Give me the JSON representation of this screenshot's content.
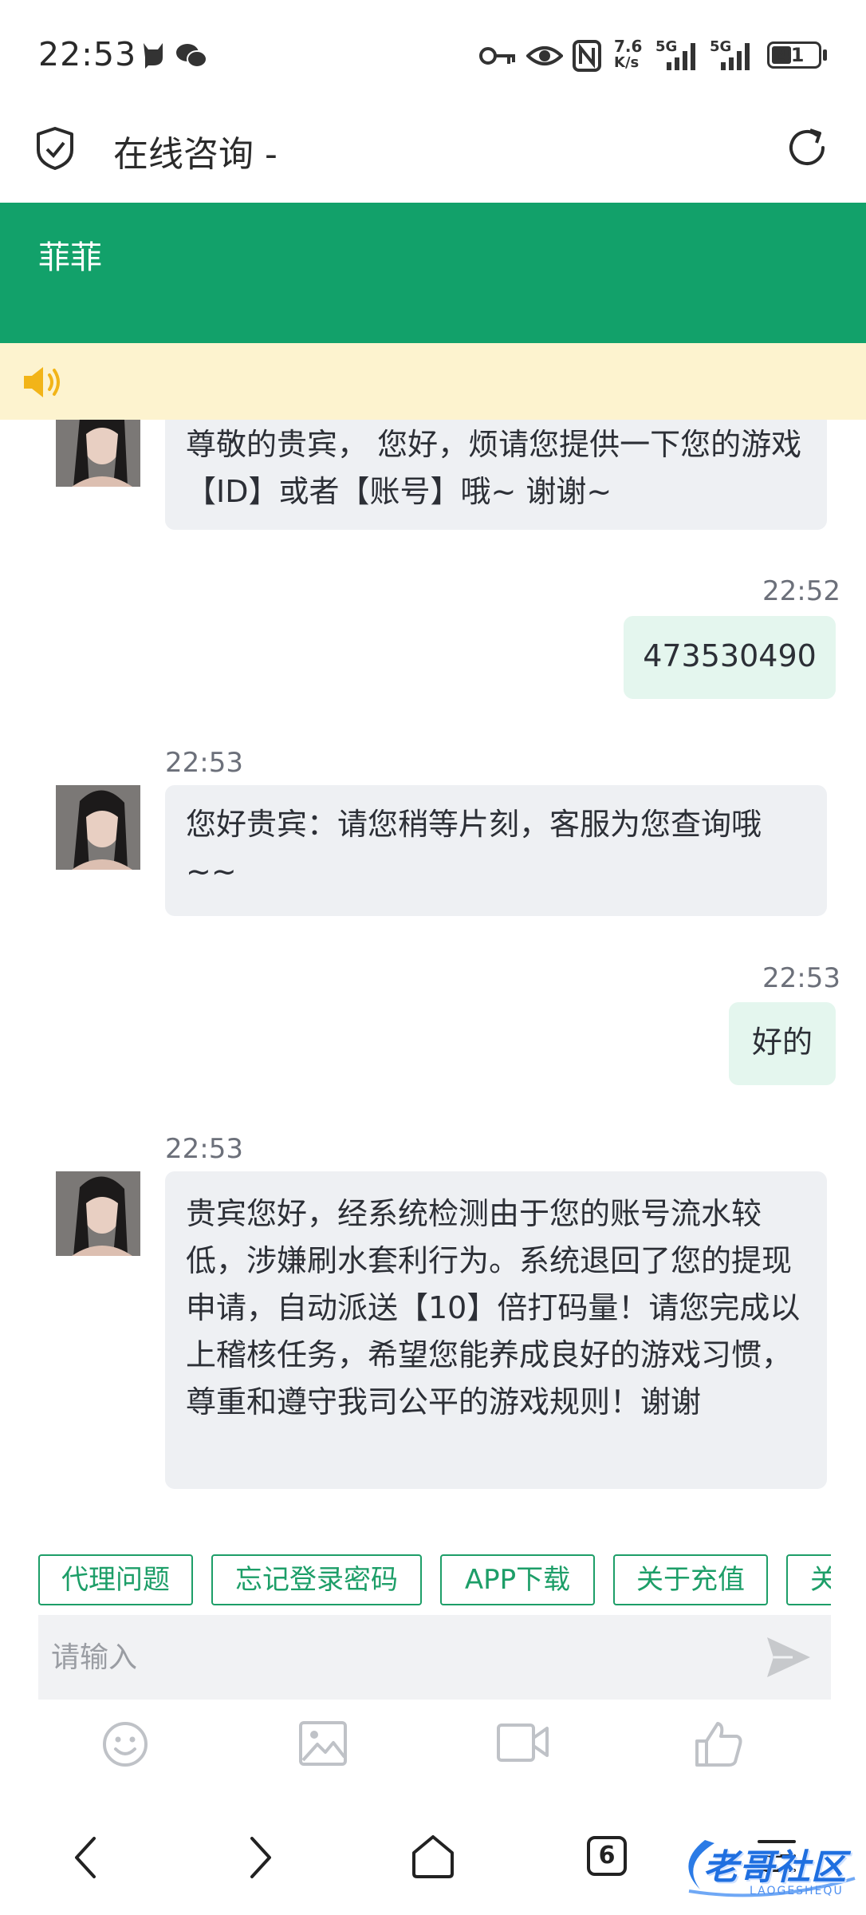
{
  "status_bar": {
    "time": "22:53",
    "net_speed": "7.6",
    "net_unit": "K/s",
    "signal1": "5G",
    "signal2": "5G",
    "battery": "41"
  },
  "browser": {
    "page_title": "在线咨询 -"
  },
  "chat": {
    "agent_name": "菲菲",
    "messages": [
      {
        "direction": "in",
        "time": "",
        "text": "尊敬的贵宾， 您好，烦请您提供一下您的游戏【ID】或者【账号】哦~ 谢谢~"
      },
      {
        "direction": "out",
        "time": "22:52",
        "text": "473530490"
      },
      {
        "direction": "in",
        "time": "22:53",
        "text": "您好贵宾：请您稍等片刻，客服为您查询哦~~"
      },
      {
        "direction": "out",
        "time": "22:53",
        "text": "好的"
      },
      {
        "direction": "in",
        "time": "22:53",
        "text": "贵宾您好，经系统检测由于您的账号流水较低，涉嫌刷水套利行为。系统退回了您的提现申请，自动派送【10】倍打码量！请您完成以上稽核任务，希望您能养成良好的游戏习惯，尊重和遵守我司公平的游戏规则！谢谢"
      }
    ]
  },
  "quick_replies": [
    "代理问题",
    "忘记登录密码",
    "APP下载",
    "关于充值",
    "关"
  ],
  "input": {
    "placeholder": "请输入",
    "value": ""
  },
  "nav": {
    "tab_count": "6"
  },
  "watermark": {
    "text": "老哥社区",
    "sub": "LAOGESHEQU"
  },
  "colors": {
    "header_green": "#12a16a",
    "notice_bg": "#fdf3cf",
    "bubble_in": "#eef0f3",
    "bubble_out": "#e4f6ee",
    "chip_green": "#1d9e68"
  }
}
